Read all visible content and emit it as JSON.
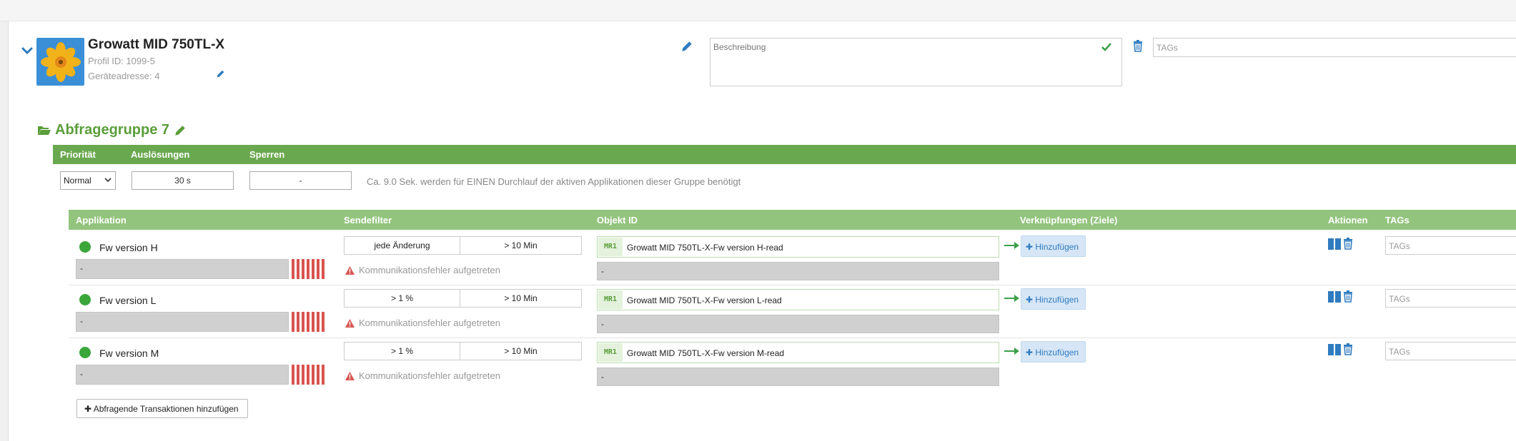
{
  "device": {
    "name": "Growatt MID 750TL-X",
    "profile_id": "Profil ID: 1099-5",
    "address": "Geräteadresse: 4",
    "description_placeholder": "Beschreibung",
    "tags_placeholder": "TAGs"
  },
  "group": {
    "title": "Abfragegruppe 7",
    "headers": {
      "priority": "Priorität",
      "triggers": "Auslösungen",
      "locks": "Sperren"
    },
    "priority_value": "Normal",
    "triggers_value": "30 s",
    "locks_value": "-",
    "info": "Ca. 9.0 Sek. werden für EINEN Durchlauf der aktiven Applikationen dieser Gruppe benötigt"
  },
  "table": {
    "headers": {
      "application": "Applikation",
      "send_filter": "Sendefilter",
      "object_id": "Objekt ID",
      "links": "Verknüpfungen (Ziele)",
      "actions": "Aktionen",
      "tags": "TAGs"
    },
    "rows": [
      {
        "name": "Fw version H",
        "value": "-",
        "filter_a": "jede Änderung",
        "filter_b": "> 10 Min",
        "error": "Kommunikationsfehler aufgetreten",
        "badge": "MR1",
        "object_id": "Growatt MID 750TL-X-Fw version H-read",
        "object_value": "-",
        "add_label": "Hinzufügen",
        "tags_placeholder": "TAGs"
      },
      {
        "name": "Fw version L",
        "value": "-",
        "filter_a": "> 1 %",
        "filter_b": "> 10 Min",
        "error": "Kommunikationsfehler aufgetreten",
        "badge": "MR1",
        "object_id": "Growatt MID 750TL-X-Fw version L-read",
        "object_value": "-",
        "add_label": "Hinzufügen",
        "tags_placeholder": "TAGs"
      },
      {
        "name": "Fw version M",
        "value": "-",
        "filter_a": "> 1 %",
        "filter_b": "> 10 Min",
        "error": "Kommunikationsfehler aufgetreten",
        "badge": "MR1",
        "object_id": "Growatt MID 750TL-X-Fw version M-read",
        "object_value": "-",
        "add_label": "Hinzufügen",
        "tags_placeholder": "TAGs"
      }
    ]
  },
  "add_transactions_label": "Abfragende Transaktionen hinzufügen",
  "colors": {
    "green_dark": "#6aa84f",
    "green_light": "#93c47d",
    "blue": "#2f7bbf",
    "red": "#d9534f"
  }
}
